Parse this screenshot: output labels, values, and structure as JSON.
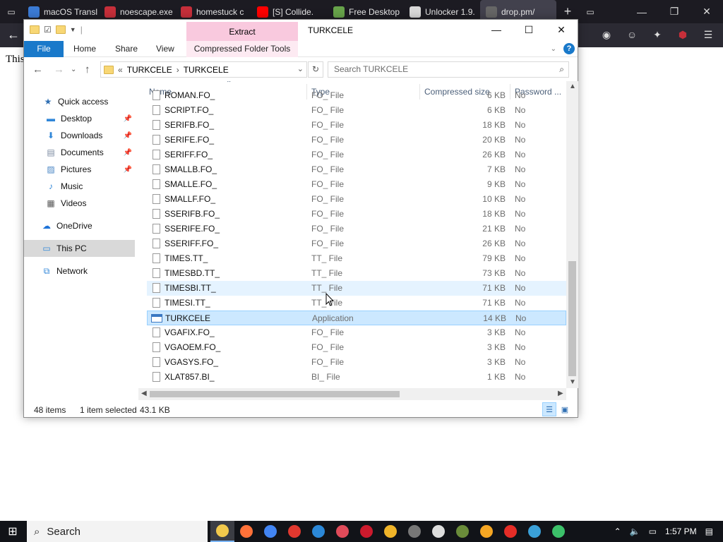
{
  "browser": {
    "tabs": [
      {
        "label": "macOS Transl",
        "icon_color": "#3b7bd5",
        "icon": "x-icon"
      },
      {
        "label": "noescape.exe",
        "icon_color": "#c62f3a",
        "icon": "letter-s-icon"
      },
      {
        "label": "homestuck c",
        "icon_color": "#c62f3a",
        "icon": "letter-s-icon"
      },
      {
        "label": "[S] Collide.",
        "icon_color": "#ff0000",
        "icon": "youtube-icon"
      },
      {
        "label": "Free Desktop",
        "icon_color": "#67a34a",
        "icon": "globe-icon"
      },
      {
        "label": "Unlocker 1.9.",
        "icon_color": "#d9d9d9",
        "icon": "letter-s-icon"
      },
      {
        "label": "drop.pm/",
        "icon_color": "#666666",
        "icon": "page-icon"
      }
    ],
    "page_text": "This"
  },
  "explorer": {
    "title": "TURKCELE",
    "extract_tab": "Extract",
    "ribbon_tabs": [
      "File",
      "Home",
      "Share",
      "View"
    ],
    "contextual_tab": "Compressed Folder Tools",
    "breadcrumb": [
      "TURKCELE",
      "TURKCELE"
    ],
    "breadcrumb_prefix": "«",
    "search_placeholder": "Search TURKCELE",
    "columns": [
      "Name",
      "Type",
      "Compressed size",
      "Password ..."
    ],
    "sidebar": [
      {
        "label": "Quick access",
        "icon": "star-icon",
        "pinned": false
      },
      {
        "label": "Desktop",
        "icon": "desktop-icon",
        "pinned": true
      },
      {
        "label": "Downloads",
        "icon": "download-icon",
        "pinned": true
      },
      {
        "label": "Documents",
        "icon": "document-icon",
        "pinned": true
      },
      {
        "label": "Pictures",
        "icon": "picture-icon",
        "pinned": true
      },
      {
        "label": "Music",
        "icon": "music-icon",
        "pinned": false
      },
      {
        "label": "Videos",
        "icon": "video-icon",
        "pinned": false
      },
      {
        "label": "OneDrive",
        "icon": "cloud-icon",
        "pinned": false
      },
      {
        "label": "This PC",
        "icon": "computer-icon",
        "pinned": false
      },
      {
        "label": "Network",
        "icon": "network-icon",
        "pinned": false
      }
    ],
    "files": [
      {
        "name": "ROMAN.FO_",
        "type": "FO_ File",
        "size": "6 KB",
        "password": "No"
      },
      {
        "name": "SCRIPT.FO_",
        "type": "FO_ File",
        "size": "6 KB",
        "password": "No"
      },
      {
        "name": "SERIFB.FO_",
        "type": "FO_ File",
        "size": "18 KB",
        "password": "No"
      },
      {
        "name": "SERIFE.FO_",
        "type": "FO_ File",
        "size": "20 KB",
        "password": "No"
      },
      {
        "name": "SERIFF.FO_",
        "type": "FO_ File",
        "size": "26 KB",
        "password": "No"
      },
      {
        "name": "SMALLB.FO_",
        "type": "FO_ File",
        "size": "7 KB",
        "password": "No"
      },
      {
        "name": "SMALLE.FO_",
        "type": "FO_ File",
        "size": "9 KB",
        "password": "No"
      },
      {
        "name": "SMALLF.FO_",
        "type": "FO_ File",
        "size": "10 KB",
        "password": "No"
      },
      {
        "name": "SSERIFB.FO_",
        "type": "FO_ File",
        "size": "18 KB",
        "password": "No"
      },
      {
        "name": "SSERIFE.FO_",
        "type": "FO_ File",
        "size": "21 KB",
        "password": "No"
      },
      {
        "name": "SSERIFF.FO_",
        "type": "FO_ File",
        "size": "26 KB",
        "password": "No"
      },
      {
        "name": "TIMES.TT_",
        "type": "TT_ File",
        "size": "79 KB",
        "password": "No"
      },
      {
        "name": "TIMESBD.TT_",
        "type": "TT_ File",
        "size": "73 KB",
        "password": "No"
      },
      {
        "name": "TIMESBI.TT_",
        "type": "TT_ File",
        "size": "71 KB",
        "password": "No",
        "state": "hover"
      },
      {
        "name": "TIMESI.TT_",
        "type": "TT_ File",
        "size": "71 KB",
        "password": "No"
      },
      {
        "name": "TURKCELE",
        "type": "Application",
        "size": "14 KB",
        "password": "No",
        "state": "selected",
        "app": true
      },
      {
        "name": "VGAFIX.FO_",
        "type": "FO_ File",
        "size": "3 KB",
        "password": "No"
      },
      {
        "name": "VGAOEM.FO_",
        "type": "FO_ File",
        "size": "3 KB",
        "password": "No"
      },
      {
        "name": "VGASYS.FO_",
        "type": "FO_ File",
        "size": "3 KB",
        "password": "No"
      },
      {
        "name": "XLAT857.BI_",
        "type": "BI_ File",
        "size": "1 KB",
        "password": "No"
      }
    ],
    "status": {
      "count": "48 items",
      "selected": "1 item selected",
      "size": "43.1 KB"
    }
  },
  "taskbar": {
    "search_label": "Search",
    "time": "1:57 PM",
    "apps": [
      {
        "icon": "file-explorer-icon",
        "color": "#f2c94c",
        "active": true
      },
      {
        "icon": "firefox-icon",
        "color": "#ff7139"
      },
      {
        "icon": "chrome-icon",
        "color": "#4285f4"
      },
      {
        "icon": "app-icon",
        "color": "#e0382f"
      },
      {
        "icon": "shield-icon",
        "color": "#2b88d8"
      },
      {
        "icon": "camera-icon",
        "color": "#e04b5a"
      },
      {
        "icon": "opera-icon",
        "color": "#cc1a2d"
      },
      {
        "icon": "game-icon",
        "color": "#f0b429"
      },
      {
        "icon": "tank-icon",
        "color": "#777777"
      },
      {
        "icon": "diamond-icon",
        "color": "#dddddd"
      },
      {
        "icon": "minecraft-icon",
        "color": "#6a8c3a"
      },
      {
        "icon": "yandex-icon",
        "color": "#f5a623"
      },
      {
        "icon": "browser-icon",
        "color": "#e52d27"
      },
      {
        "icon": "monitor-icon",
        "color": "#3aa0d8"
      },
      {
        "icon": "bucket-icon",
        "color": "#3cc16a"
      }
    ]
  }
}
